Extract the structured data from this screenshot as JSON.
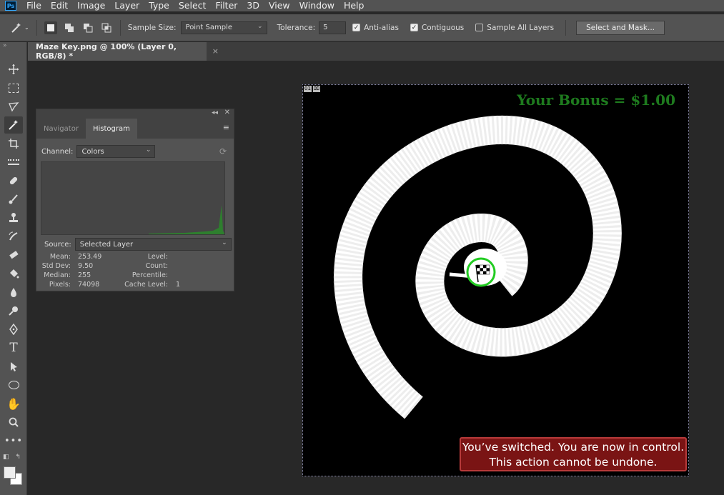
{
  "menubar": {
    "logo": "Ps",
    "items": [
      "File",
      "Edit",
      "Image",
      "Layer",
      "Type",
      "Select",
      "Filter",
      "3D",
      "View",
      "Window",
      "Help"
    ]
  },
  "options": {
    "sample_size_label": "Sample Size:",
    "sample_size_value": "Point Sample",
    "tolerance_label": "Tolerance:",
    "tolerance_value": "5",
    "anti_alias_label": "Anti-alias",
    "anti_alias_checked": true,
    "contiguous_label": "Contiguous",
    "contiguous_checked": true,
    "sample_all_layers_label": "Sample All Layers",
    "sample_all_layers_checked": false,
    "select_mask_label": "Select and Mask..."
  },
  "document": {
    "tab_title": "Maze Key.png @ 100% (Layer 0, RGB/8) *",
    "close_glyph": "×",
    "badge": [
      "01",
      "⌧"
    ]
  },
  "panel": {
    "tabs": [
      "Navigator",
      "Histogram"
    ],
    "active_tab": "Histogram",
    "channel_label": "Channel:",
    "channel_value": "Colors",
    "source_label": "Source:",
    "source_value": "Selected Layer",
    "stats_left": [
      {
        "label": "Mean:",
        "value": "253.49"
      },
      {
        "label": "Std Dev:",
        "value": "9.50"
      },
      {
        "label": "Median:",
        "value": "255"
      },
      {
        "label": "Pixels:",
        "value": "74098"
      }
    ],
    "stats_right": [
      {
        "label": "Level:",
        "value": ""
      },
      {
        "label": "Count:",
        "value": ""
      },
      {
        "label": "Percentile:",
        "value": ""
      },
      {
        "label": "Cache Level:",
        "value": "1"
      }
    ]
  },
  "image": {
    "bonus_text": "Your Bonus = $1.00",
    "alert_line1": "You’ve switched. You are now in control.",
    "alert_line2": "This action cannot be undone."
  },
  "colors": {
    "app_bg": "#282828",
    "panel_bg": "#535353",
    "bonus_green": "#1e7a1e",
    "alert_red": "#7a1414",
    "goal_ring": "#22cc22"
  },
  "tools": [
    "move-tool",
    "marquee-tool",
    "lasso-tool",
    "magic-wand-tool",
    "crop-tool",
    "frame-tool",
    "healing-brush-tool",
    "brush-tool",
    "clone-stamp-tool",
    "history-brush-tool",
    "eraser-tool",
    "paint-bucket-tool",
    "blur-tool",
    "dodge-tool",
    "pen-tool",
    "type-tool",
    "path-selection-tool",
    "ellipse-tool",
    "hand-tool",
    "zoom-tool",
    "more-tools"
  ]
}
